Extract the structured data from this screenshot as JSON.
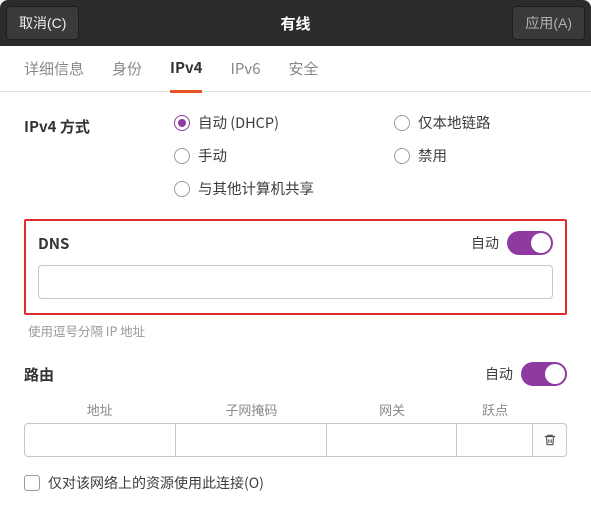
{
  "titlebar": {
    "cancel": "取消(C)",
    "title": "有线",
    "apply": "应用(A)"
  },
  "tabs": {
    "details": "详细信息",
    "identity": "身份",
    "ipv4": "IPv4",
    "ipv6": "IPv6",
    "security": "安全"
  },
  "ipv4": {
    "method_label": "IPv4 方式",
    "options": {
      "auto": "自动 (DHCP)",
      "link_local": "仅本地链路",
      "manual": "手动",
      "disable": "禁用",
      "shared": "与其他计算机共享"
    }
  },
  "dns": {
    "title": "DNS",
    "auto_label": "自动",
    "value": "",
    "helper": "使用逗号分隔 IP 地址"
  },
  "routes": {
    "title": "路由",
    "auto_label": "自动",
    "columns": {
      "address": "地址",
      "netmask": "子网掩码",
      "gateway": "网关",
      "metric": "跃点"
    },
    "only_resources": "仅对该网络上的资源使用此连接(O)"
  }
}
